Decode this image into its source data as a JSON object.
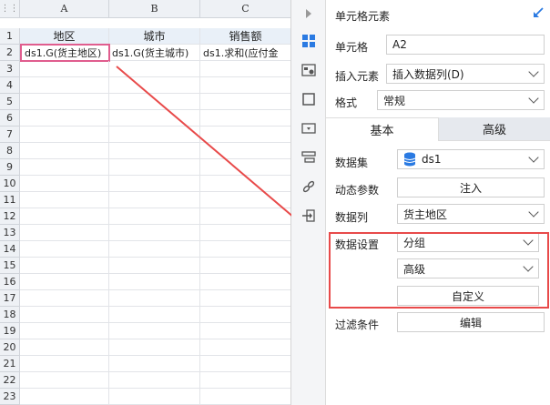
{
  "sheet": {
    "corner_symbol": "⋮⋮",
    "columns": [
      "A",
      "B",
      "C"
    ],
    "rows": [
      "1",
      "2",
      "3",
      "4",
      "5",
      "6",
      "7",
      "8",
      "9",
      "10",
      "11",
      "12",
      "13",
      "14",
      "15",
      "16",
      "17",
      "18",
      "19",
      "20",
      "21",
      "22",
      "23"
    ],
    "header_row": [
      "地区",
      "城市",
      "销售额"
    ],
    "data_row": [
      "ds1.G(货主地区)",
      "ds1.G(货主城市)",
      "ds1.求和(应付金"
    ],
    "selected_cell": "A2"
  },
  "panel": {
    "title": "单元格元素",
    "cell_label": "单元格",
    "cell_value": "A2",
    "insert_label": "插入元素",
    "insert_value": "插入数据列(D)",
    "format_label": "格式",
    "format_value": "常规",
    "tabs": [
      "基本",
      "高级"
    ],
    "dataset_label": "数据集",
    "dataset_value": "ds1",
    "dynamic_label": "动态参数",
    "dynamic_button": "注入",
    "column_label": "数据列",
    "column_value": "货主地区",
    "setting_label": "数据设置",
    "setting_value": "分组",
    "setting_sub_value": "高级",
    "custom_button": "自定义",
    "filter_label": "过滤条件",
    "filter_button": "编辑"
  },
  "colors": {
    "accent": "#2a7ae2",
    "highlight": "#e84a4a",
    "selection": "#e05d8e"
  }
}
